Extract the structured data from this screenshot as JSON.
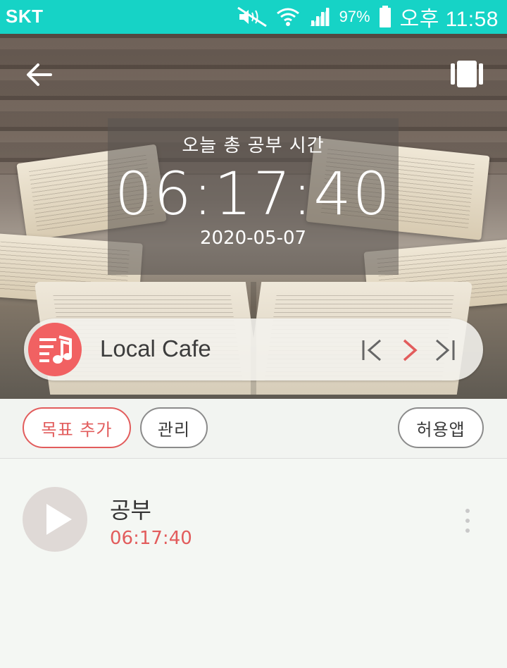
{
  "status_bar": {
    "carrier": "SKT",
    "battery_percent": "97%",
    "time": "오후 11:58",
    "icons": [
      "mute-icon",
      "wifi-icon",
      "signal-icon",
      "battery-icon"
    ]
  },
  "hero": {
    "icons": [
      "back-arrow-icon",
      "book-icon"
    ],
    "timer": {
      "label": "오늘 총 공부 시간",
      "value": "06:17:40",
      "date": "2020-05-07"
    }
  },
  "music": {
    "title": "Local Cafe",
    "icons": [
      "music-playlist-icon",
      "skip-previous-icon",
      "play-next-icon",
      "skip-next-icon"
    ],
    "accent_color": "#f16162"
  },
  "buttons": {
    "add_goal": "목표 추가",
    "manage": "관리",
    "allowed_apps": "허용앱"
  },
  "items": [
    {
      "title": "공부",
      "time": "06:17:40",
      "icons": [
        "play-icon",
        "more-options-icon"
      ]
    }
  ],
  "colors": {
    "status_bar": "#16d3c6",
    "accent": "#e25c5c"
  }
}
